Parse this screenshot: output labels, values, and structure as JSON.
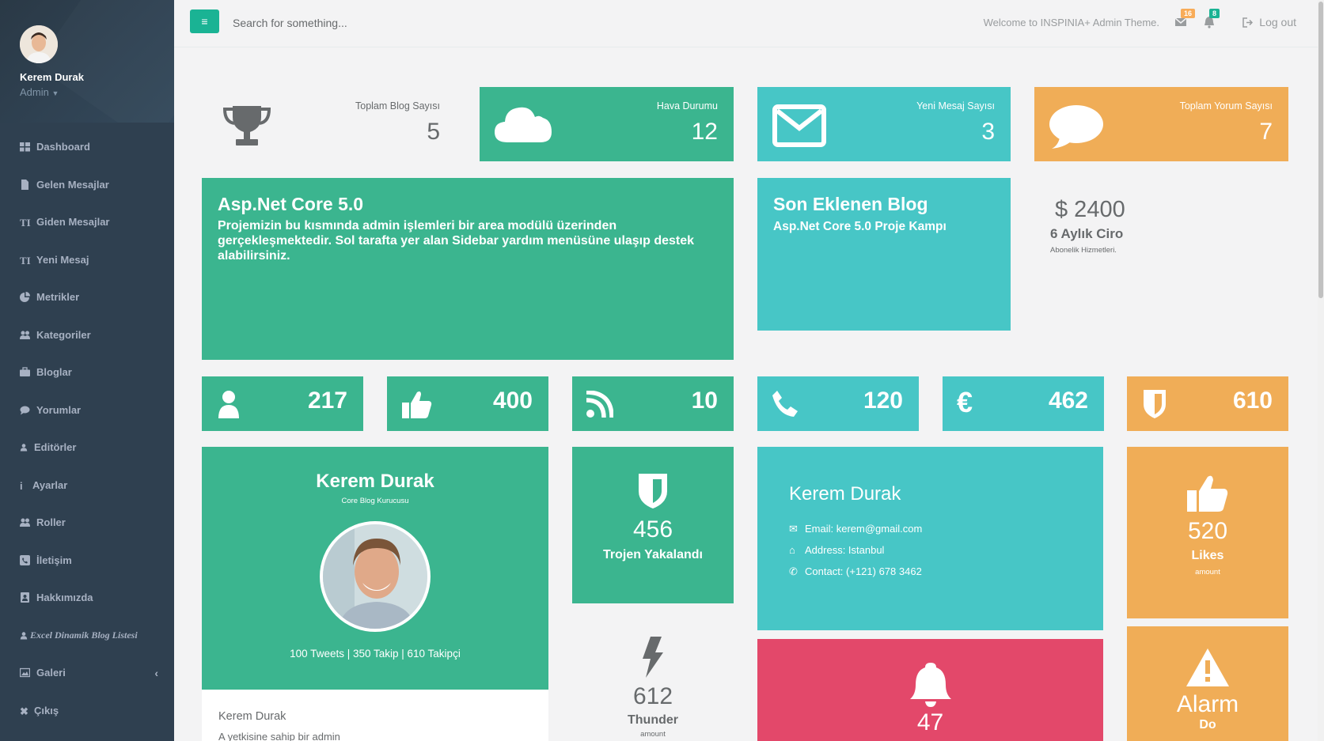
{
  "sidebar": {
    "user_name": "Kerem Durak",
    "user_role": "Admin",
    "items": [
      {
        "label": "Dashboard",
        "icon": "dashboard-icon"
      },
      {
        "label": "Gelen Mesajlar",
        "icon": "file-icon"
      },
      {
        "label": "Giden Mesajlar",
        "icon": "text-height-icon"
      },
      {
        "label": "Yeni Mesaj",
        "icon": "text-height-icon"
      },
      {
        "label": "Metrikler",
        "icon": "pie-chart-icon"
      },
      {
        "label": "Kategoriler",
        "icon": "users-icon"
      },
      {
        "label": "Bloglar",
        "icon": "briefcase-icon"
      },
      {
        "label": "Yorumlar",
        "icon": "comment-icon"
      },
      {
        "label": "Editörler",
        "icon": "user-icon"
      },
      {
        "label": "Ayarlar",
        "icon": "info-icon"
      },
      {
        "label": "Roller",
        "icon": "users-icon"
      },
      {
        "label": "İletişim",
        "icon": "phone-square-icon"
      },
      {
        "label": "Hakkımızda",
        "icon": "address-book-icon"
      },
      {
        "label": "Excel Dinamik Blog Listesi",
        "icon": "user-icon"
      },
      {
        "label": "Galeri",
        "icon": "picture-icon"
      },
      {
        "label": "Çıkış",
        "icon": "close-icon"
      }
    ]
  },
  "topbar": {
    "search_placeholder": "Search for something...",
    "welcome": "Welcome to INSPINIA+ Admin Theme.",
    "mail_count": "16",
    "alert_count": "8",
    "logout_label": "Log out"
  },
  "widgets": {
    "blog_count": {
      "label": "Toplam Blog Sayısı",
      "value": "5"
    },
    "weather": {
      "label": "Hava Durumu",
      "value": "12"
    },
    "messages": {
      "label": "Yeni Mesaj Sayısı",
      "value": "3"
    },
    "comments": {
      "label": "Toplam Yorum Sayısı",
      "value": "7"
    }
  },
  "intro": {
    "title": "Asp.Net Core 5.0",
    "text": "Projemizin bu kısmında admin işlemleri bir area modülü üzerinden gerçekleşmektedir. Sol tarafta yer alan Sidebar yardım menüsüne ulaşıp destek alabilirsiniz."
  },
  "latest_blog": {
    "title": "Son Eklenen Blog",
    "subtitle": "Asp.Net Core 5.0 Proje Kampı"
  },
  "revenue": {
    "amount": "$ 2400",
    "label": "6 Aylık Ciro",
    "sub": "Abonelik Hizmetleri."
  },
  "stats": [
    {
      "value": "217",
      "icon": "user-icon"
    },
    {
      "value": "400",
      "icon": "thumbs-up-icon"
    },
    {
      "value": "10",
      "icon": "rss-icon"
    },
    {
      "value": "120",
      "icon": "phone-icon"
    },
    {
      "value": "462",
      "icon": "euro-icon"
    },
    {
      "value": "610",
      "icon": "shield-icon"
    }
  ],
  "profile_card": {
    "name": "Kerem Durak",
    "role": "Core Blog Kurucusu",
    "stats": "100 Tweets | 350 Takip | 610 Takipçi",
    "footer_name": "Kerem Durak",
    "footer_text": "A yetkisine sahip bir admin"
  },
  "trojan": {
    "value": "456",
    "label": "Trojen Yakalandı"
  },
  "thunder": {
    "value": "612",
    "label": "Thunder",
    "sub": "amount"
  },
  "contact_card": {
    "name": "Kerem Durak",
    "email": "Email: kerem@gmail.com",
    "address": "Address: Istanbul",
    "contact": "Contact: (+121) 678 3462"
  },
  "alert_card": {
    "value": "47"
  },
  "likes": {
    "value": "520",
    "label": "Likes",
    "sub": "amount"
  },
  "alarm": {
    "label": "Alarm",
    "sub": "Do"
  },
  "colors": {
    "green": "#3bb58f",
    "teal": "#47c6c6",
    "orange": "#f0ad57",
    "red": "#e3486a",
    "sidebar": "#2f4050"
  }
}
